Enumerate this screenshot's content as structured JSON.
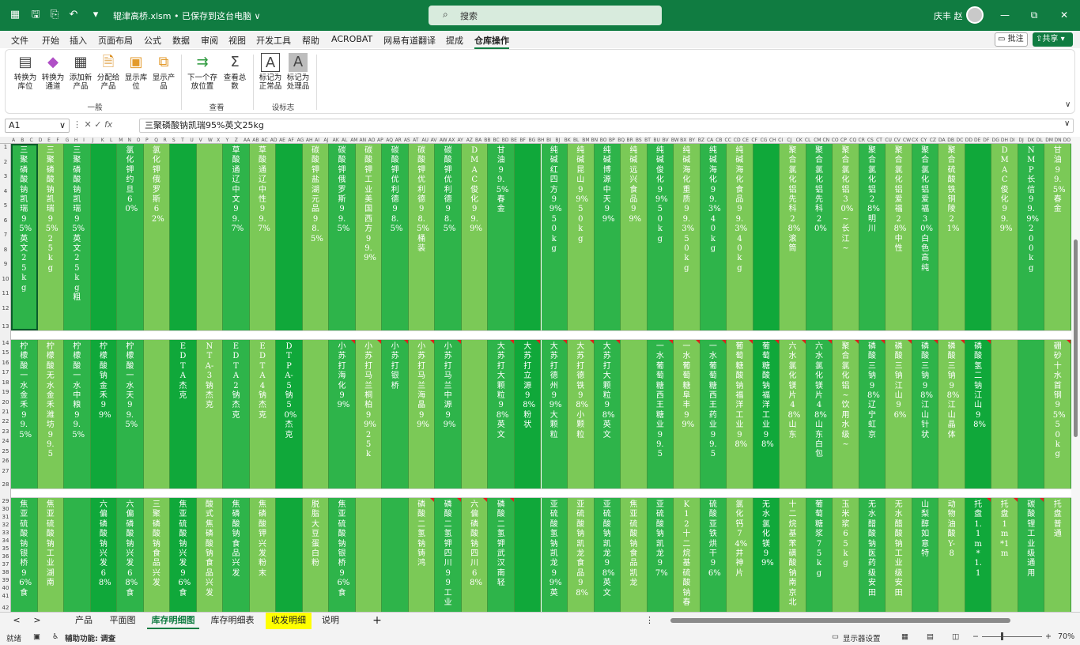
{
  "titlebar": {
    "filename": "辊津高桥.xlsm • 已保存到这台电脑 ∨",
    "search_placeholder": "搜索",
    "user_name": "庆丰 赵",
    "minimize": "—",
    "restore": "⧉",
    "close": "✕"
  },
  "menubar": {
    "items": [
      "文件",
      "开始",
      "插入",
      "页面布局",
      "公式",
      "数据",
      "审阅",
      "视图",
      "开发工具",
      "帮助",
      "ACROBAT",
      "网易有道翻译",
      "提成",
      "仓库操作"
    ],
    "comment_label": "批注",
    "share_label": "共享"
  },
  "ribbon": {
    "groups": [
      {
        "label": "一般",
        "buttons": [
          {
            "label": "转换为库位",
            "icon": "convert-location-icon"
          },
          {
            "label": "转换为通道",
            "icon": "convert-channel-icon"
          },
          {
            "label": "添加新产品",
            "icon": "add-product-icon"
          },
          {
            "label": "分配给产品",
            "icon": "assign-product-icon"
          },
          {
            "label": "显示库位",
            "icon": "show-location-icon"
          },
          {
            "label": "显示产品",
            "icon": "show-product-icon"
          }
        ]
      },
      {
        "label": "查看",
        "buttons": [
          {
            "label": "下一个存放位置",
            "icon": "next-arrow-icon"
          },
          {
            "label": "查看总数",
            "icon": "sum-icon"
          }
        ]
      },
      {
        "label": "设标志",
        "buttons": [
          {
            "label": "标记为正常品",
            "icon": "mark-normal-icon"
          },
          {
            "label": "标记为处理品",
            "icon": "mark-handled-icon"
          }
        ]
      }
    ]
  },
  "formula_bar": {
    "cell_ref": "A1",
    "formula": "三聚磷酸钠凯瑞95%英文25kg"
  },
  "columns": [
    "A",
    "B",
    "C",
    "D",
    "E",
    "F",
    "G",
    "H",
    "I",
    "J",
    "K",
    "L",
    "M",
    "N",
    "O",
    "P",
    "Q",
    "R",
    "S",
    "T",
    "U",
    "V",
    "W",
    "X",
    "Y",
    "Z",
    "AA",
    "AB",
    "AC",
    "AD",
    "AE",
    "AF",
    "AG",
    "AH",
    "AI",
    "AJ",
    "AK",
    "AL",
    "AM",
    "AN",
    "AO",
    "AP",
    "AQ",
    "AR",
    "AS",
    "AT",
    "AU",
    "AV",
    "AW",
    "AX",
    "AY",
    "AZ",
    "BA",
    "BB",
    "BC",
    "BD",
    "BE",
    "BF",
    "BG",
    "BH",
    "BI",
    "BJ",
    "BK",
    "BL",
    "BM",
    "BN",
    "BO",
    "BP",
    "BQ",
    "BR",
    "BS",
    "BT",
    "BU",
    "BV",
    "BW",
    "BX",
    "BY",
    "BZ",
    "CA",
    "CB",
    "CC",
    "CD",
    "CE",
    "CF",
    "CG",
    "CH",
    "CI",
    "CJ",
    "CK",
    "CL",
    "CM",
    "CN",
    "CO",
    "CP",
    "CQ",
    "CR",
    "CS",
    "CT",
    "CU",
    "CV",
    "CW",
    "CX",
    "CY",
    "CZ",
    "DA",
    "DB",
    "DC",
    "DD",
    "DE",
    "DF",
    "DG",
    "DH",
    "DI",
    "DJ",
    "DK",
    "DL",
    "DM",
    "DN",
    "DO"
  ],
  "rows_band1": [
    "1",
    "2",
    "3",
    "4",
    "5",
    "6",
    "7",
    "8",
    "9",
    "10",
    "11",
    "12",
    "13"
  ],
  "rows_band2": [
    "14",
    "15",
    "16",
    "17",
    "18",
    "19",
    "20",
    "21",
    "22",
    "23",
    "24",
    "25",
    "26",
    "27",
    "28"
  ],
  "rows_band3": [
    "29",
    "30",
    "31",
    "32",
    "33",
    "34",
    "35",
    "36",
    "37",
    "38",
    "39",
    "40",
    "41",
    "42"
  ],
  "row_labels_extra": [
    "14",
    "15",
    "16",
    "17",
    "18"
  ],
  "grid": [
    [
      "三聚磷酸钠凯瑞95%英文25kg",
      "三聚磷酸钠凯瑞95%25kg",
      "三聚磷酸钠凯瑞95%英文25kg粗",
      "",
      "氯化钾约旦60%",
      "氯化钾俄罗斯62%",
      "",
      "",
      "草酸通辽中文99.7%",
      "草酸通辽中性99.7%",
      "",
      "碳酸钾盐湖元品98.5%",
      "碳酸钾俄罗斯99.5%",
      "碳酸钾工业美国西方99.9%",
      "碳酸钾优利德98.5%",
      "碳酸钾优利德98.5%桶装",
      "碳酸钾优利德98.5%",
      "DMAC俊化99.9%",
      "甘油99.5%春金",
      "",
      "纯碱红四方99%50kg",
      "纯碱昆山99%50kg",
      "纯碱博源中天99%",
      "纯碱远兴食品99%",
      "纯碱俊化99%50kg",
      "纯碱海化重质99.3%50kg",
      "纯碱海化99.3%40kg",
      "纯碱海化食品99.3%40kg",
      "",
      "聚合氯化铝先科28%滚筒",
      "聚合氯化铝先科20%",
      "聚合氯化铝30%~长江~",
      "聚合氯化铝28%明川",
      "聚合氯化铝爱福28%中性",
      "聚合氯化铝爱福30%白色高纯",
      "聚合硫酸铁铜陵21%",
      "",
      "DMAC俊化99.9%",
      "NMP长信99.9%200kg",
      "甘油99.5%春金"
    ],
    [
      "柠檬酸一水金禾99.5%",
      "柠檬酸无水金禾潍坊99.5",
      "柠檬酸一水中粮99.5%",
      "柠檬酸钠金禾99%",
      "柠檬酸一水天99.5%",
      "",
      "EDTA杰克",
      "NTA-3钠杰克",
      "EDTA2钠杰克",
      "EDTA4钠杰克",
      "DTPA-5钠50%杰克",
      "",
      "小苏打海化99%",
      "小苏打马兰桐柏99%25k",
      "小苏打银桥",
      "小苏打马兰海晶99%",
      "小苏打马兰中源99%",
      "",
      "大苏打大颗粒98%英文",
      "大苏打立源98%粉状",
      "大苏打德州99%大颗粒",
      "大苏打德铁98%小颗粒",
      "大苏打大颗粒98%英文",
      "",
      "一水葡萄糖西王糖业99.5",
      "一水葡萄糖阜丰99%",
      "一水葡萄糖西王药业99.5",
      "葡萄糖酸钠福洋工业98%",
      "葡萄糖酸钠福洋工业98%",
      "六水氯化镁片48%山东",
      "六水氯化镁片48%山东白包",
      "聚合氯化铝~饮用水级~",
      "磷酸三钠98%辽宁虹京",
      "磷酸三钠江山96%",
      "磷酸三钠98%江山针状",
      "磷酸三钠98%江山晶体",
      "磷酸氢二钠江山98%",
      "",
      "",
      "硼砂十水首钢95%50kg",
      "硼砂十水土耳其99%"
    ],
    [
      "焦亚硫酸钠银桥96%食",
      "焦亚硫酸钠工业湖南",
      "",
      "六偏磷酸钠兴发68%",
      "六偏磷酸钠兴发68%食",
      "三聚磷酸钠食品兴发",
      "焦亚硫酸钠兴发96%食",
      "酸式焦磷酸钠食品兴发",
      "焦磷酸钠食品兴发",
      "焦磷酸钾兴发粉末",
      "",
      "脱脂大豆蛋白粉",
      "焦亚硫酸钠银桥96%食",
      "",
      "",
      "磷酸二氢钠铸鸿",
      "磷酸二氢钾四川99工业",
      "六偏磷酸钠四川68%",
      "磷酸二氢钾武汉南轻",
      "",
      "亚硫酸氢钠凯龙99%英",
      "亚硫酸钠凯龙食品98%",
      "亚硫酸钠凯龙98%英文",
      "焦亚硫酸钠食品凯龙",
      "亚硫酸钠凯龙97%",
      "K12十二烷基硫酸钠春",
      "硫酸亚铁烘干96%",
      "氯化钙74%井神片",
      "无水氯化镁99%",
      "十二烷基苯磺酸钠南京北",
      "葡萄糖浆75kg",
      "玉米浆65kg",
      "无水醋酸钠医药级安田",
      "无水醋酸钠工业级安田",
      "山梨醇如意特",
      "动物油酸Y-8",
      "托盘1.1m*1.1",
      "托盘1m*1m",
      "碳酸锂工业级通用",
      "托盘普通"
    ]
  ],
  "col_colors": [
    "#2eb44a",
    "#7bc957",
    "#2eb44a",
    "#10a83a",
    "#2eb44a",
    "#7bc957",
    "#10a83a",
    "#7bc957",
    "#2eb44a",
    "#7bc957",
    "#10a83a",
    "#7bc957",
    "#2eb44a",
    "#7bc957",
    "#2eb44a",
    "#7bc957",
    "#2eb44a",
    "#7bc957",
    "#2eb44a",
    "#10a83a",
    "#2eb44a",
    "#7bc957",
    "#2eb44a",
    "#7bc957",
    "#2eb44a",
    "#7bc957",
    "#2eb44a",
    "#7bc957",
    "#10a83a",
    "#7bc957",
    "#2eb44a",
    "#7bc957",
    "#2eb44a",
    "#7bc957",
    "#2eb44a",
    "#7bc957",
    "#10a83a",
    "#7bc957",
    "#2eb44a",
    "#7bc957"
  ],
  "tabs": {
    "items": [
      "产品",
      "平面图",
      "库存明细图",
      "库存明细表",
      "收发明细",
      "说明"
    ],
    "active": "库存明细图",
    "highlight": "收发明细",
    "add": "+",
    "nav_left": "<",
    "nav_right": ">"
  },
  "status": {
    "ready": "就绪",
    "accessibility": "辅助功能: 调查",
    "display_settings": "显示器设置",
    "zoom": "70%"
  }
}
